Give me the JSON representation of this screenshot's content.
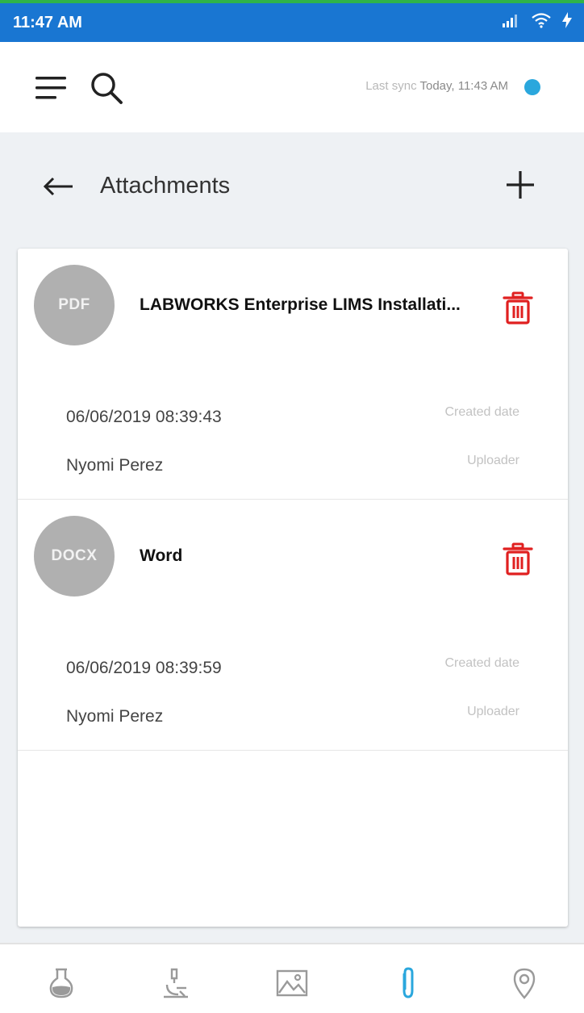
{
  "status_bar": {
    "time": "11:47 AM",
    "icons": [
      "signal-icon",
      "wifi-icon",
      "charging-icon"
    ]
  },
  "app_bar": {
    "icons": [
      "menu-icon",
      "search-icon"
    ],
    "last_sync_label": "Last sync",
    "last_sync_value": "Today, 11:43 AM",
    "sync_indicator_color": "#2aa7dd"
  },
  "page": {
    "title": "Attachments",
    "back_icon": "back-arrow-icon",
    "add_icon": "add-icon"
  },
  "attachments": [
    {
      "type": "PDF",
      "name": "LABWORKS Enterprise LIMS Installati...",
      "created_date": "06/06/2019 08:39:43",
      "created_date_label": "Created date",
      "uploader": "Nyomi Perez",
      "uploader_label": "Uploader",
      "delete_icon": "trash-icon"
    },
    {
      "type": "DOCX",
      "name": "Word",
      "created_date": "06/06/2019 08:39:59",
      "created_date_label": "Created date",
      "uploader": "Nyomi Perez",
      "uploader_label": "Uploader",
      "delete_icon": "trash-icon"
    }
  ],
  "bottom_nav": {
    "items": [
      "flask-icon",
      "microscope-icon",
      "image-icon",
      "paperclip-icon",
      "location-pin-icon"
    ],
    "active": "paperclip-icon",
    "active_color": "#2aa7dd"
  },
  "colors": {
    "status_bar": "#1976d2",
    "delete": "#e02020",
    "badge": "#b0b0b0"
  }
}
